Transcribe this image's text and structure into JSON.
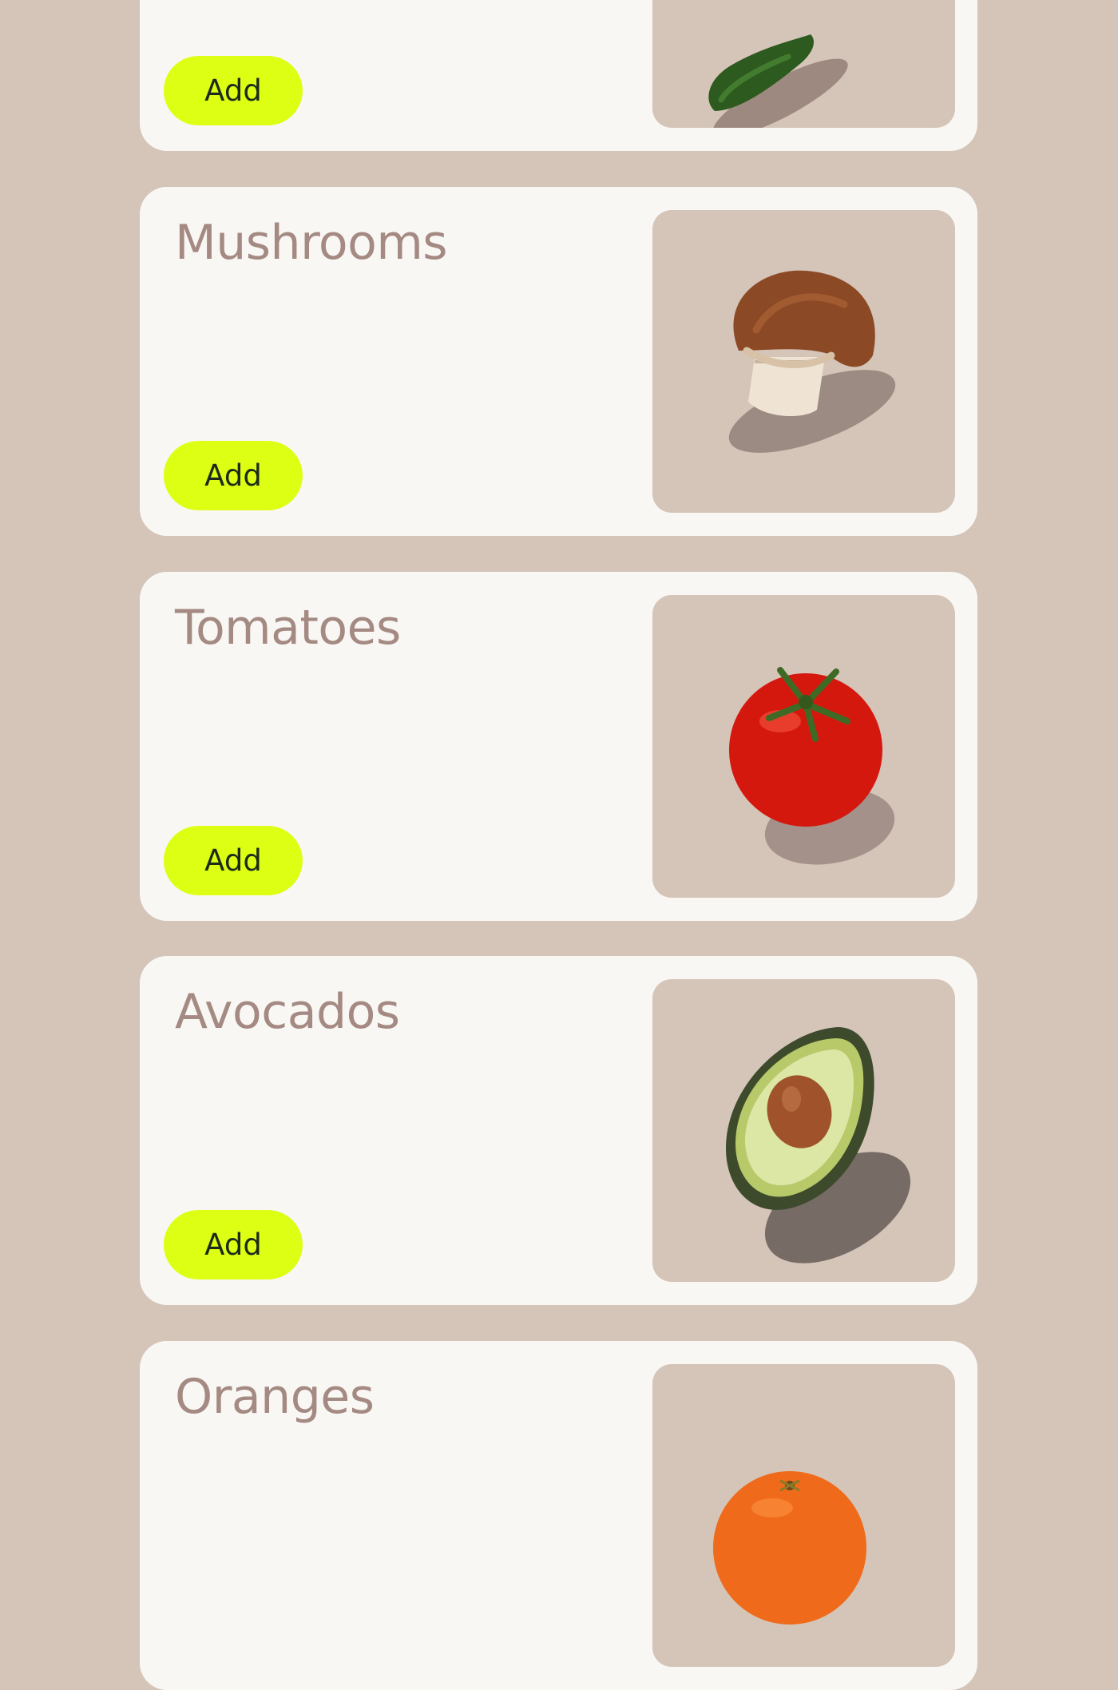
{
  "page": {
    "background_color": "#d5c4b8",
    "card_color": "#f9f7f4",
    "accent_color": "#dcff14"
  },
  "products": [
    {
      "name": "",
      "button_label": "Add",
      "image_icon": "jalapeno-pepper-image"
    },
    {
      "name": "Mushrooms",
      "button_label": "Add",
      "image_icon": "mushroom-image"
    },
    {
      "name": "Tomatoes",
      "button_label": "Add",
      "image_icon": "tomato-image"
    },
    {
      "name": "Avocados",
      "button_label": "Add",
      "image_icon": "avocado-image"
    },
    {
      "name": "Oranges",
      "button_label": "",
      "image_icon": "orange-image"
    }
  ]
}
